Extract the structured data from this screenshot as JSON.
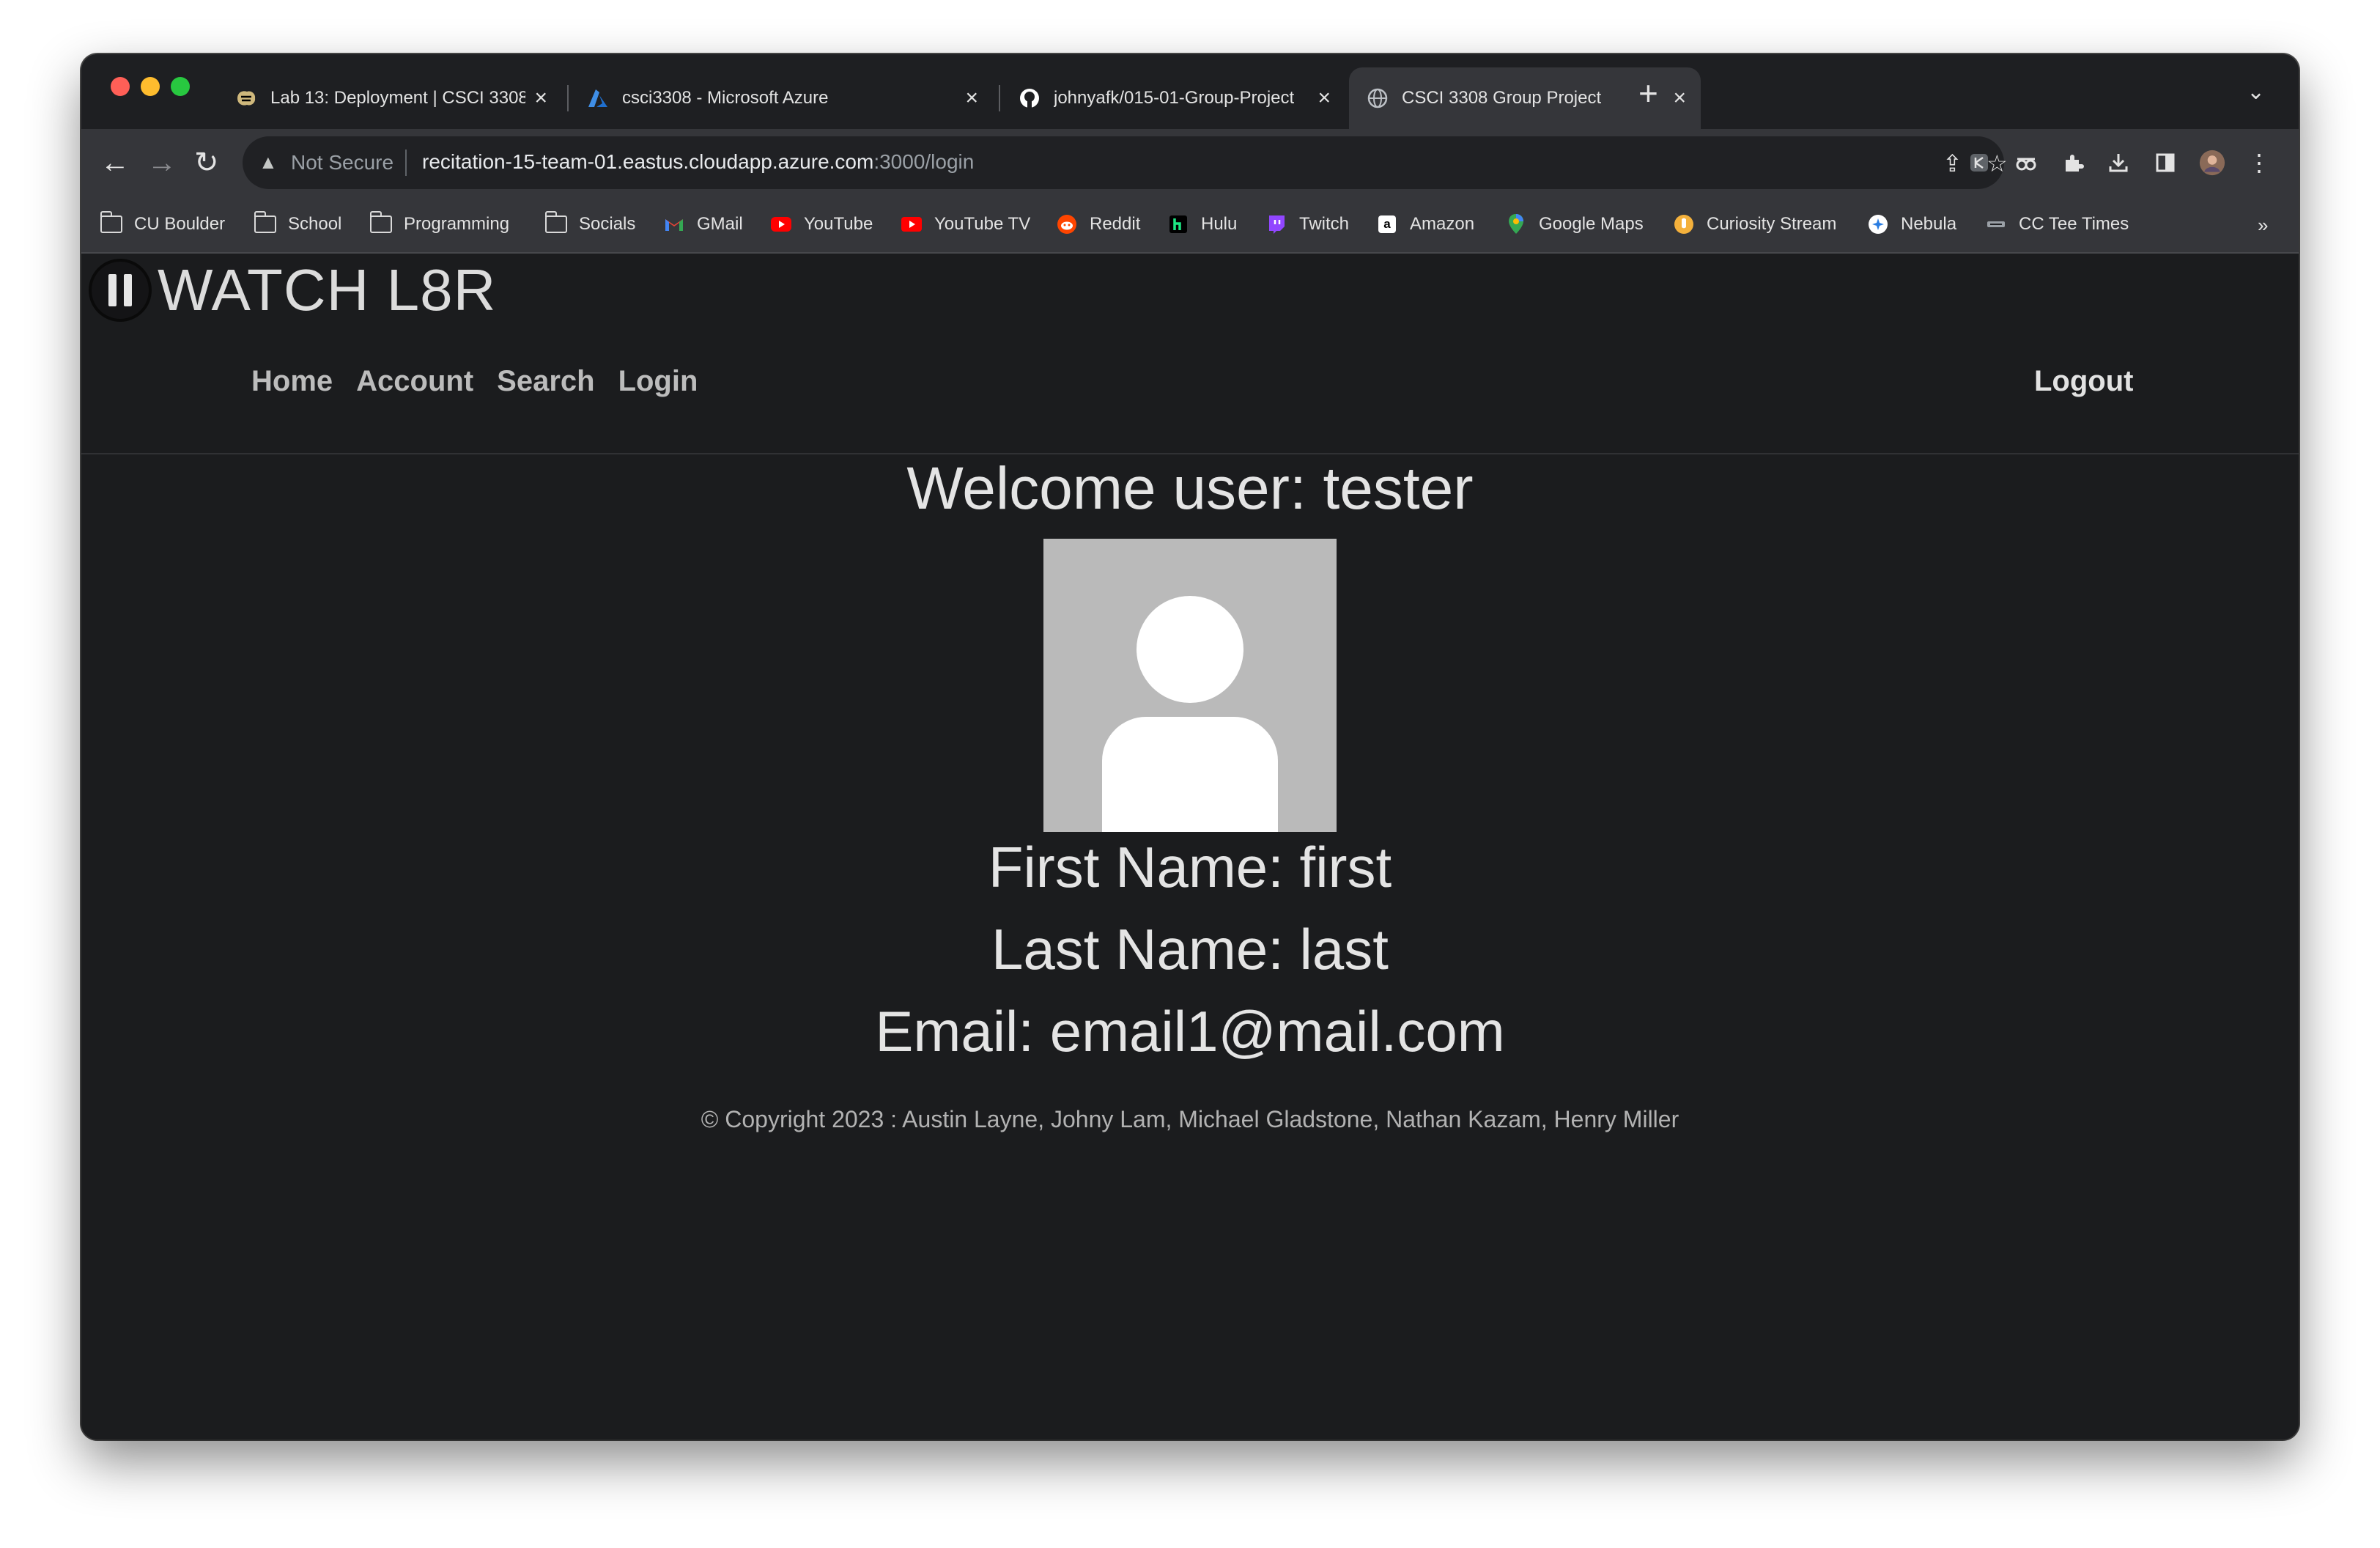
{
  "browser": {
    "tabs": [
      {
        "title": "Lab 13: Deployment | CSCI 3308",
        "active": false,
        "favicon": "cu-buffalo-icon"
      },
      {
        "title": "csci3308 - Microsoft Azure",
        "active": false,
        "favicon": "azure-icon"
      },
      {
        "title": "johnyafk/015-01-Group-Project",
        "active": false,
        "favicon": "github-icon"
      },
      {
        "title": "CSCI 3308 Group Project",
        "active": true,
        "favicon": "globe-icon"
      }
    ],
    "address_bar": {
      "security_label": "Not Secure",
      "url_host": "recitation-15-team-01.eastus.cloudapp.azure.com",
      "url_path": ":3000/login"
    },
    "bookmarks": [
      {
        "label": "CU Boulder",
        "icon": "folder-icon"
      },
      {
        "label": "School",
        "icon": "folder-icon"
      },
      {
        "label": "Programming",
        "icon": "folder-icon"
      },
      {
        "label": "Socials",
        "icon": "folder-icon"
      },
      {
        "label": "GMail",
        "icon": "gmail-icon"
      },
      {
        "label": "YouTube",
        "icon": "youtube-icon"
      },
      {
        "label": "YouTube TV",
        "icon": "youtube-tv-icon"
      },
      {
        "label": "Reddit",
        "icon": "reddit-icon"
      },
      {
        "label": "Hulu",
        "icon": "hulu-icon"
      },
      {
        "label": "Twitch",
        "icon": "twitch-icon"
      },
      {
        "label": "Amazon",
        "icon": "amazon-icon"
      },
      {
        "label": "Google Maps",
        "icon": "google-maps-icon"
      },
      {
        "label": "Curiosity Stream",
        "icon": "curiosity-stream-icon"
      },
      {
        "label": "Nebula",
        "icon": "nebula-icon"
      },
      {
        "label": "CC Tee Times",
        "icon": "cc-tee-times-icon"
      }
    ],
    "bookmarks_overflow": "»"
  },
  "site": {
    "brand": "WATCH L8R",
    "nav": [
      "Home",
      "Account",
      "Search",
      "Login"
    ],
    "logout": "Logout"
  },
  "profile": {
    "welcome": "Welcome user: tester",
    "first_name": "First Name: first",
    "last_name": "Last Name: last",
    "email": "Email: email1@mail.com"
  },
  "footer": {
    "copyright": "© Copyright 2023 : Austin Layne, Johny Lam, Michael Gladstone, Nathan Kazam, Henry Miller"
  },
  "colors": {
    "page_background": "#1b1c1e",
    "avatar_background": "#bababa",
    "traffic_close": "#ff5f57",
    "traffic_minimize": "#febc2e",
    "traffic_zoom": "#28c840"
  }
}
